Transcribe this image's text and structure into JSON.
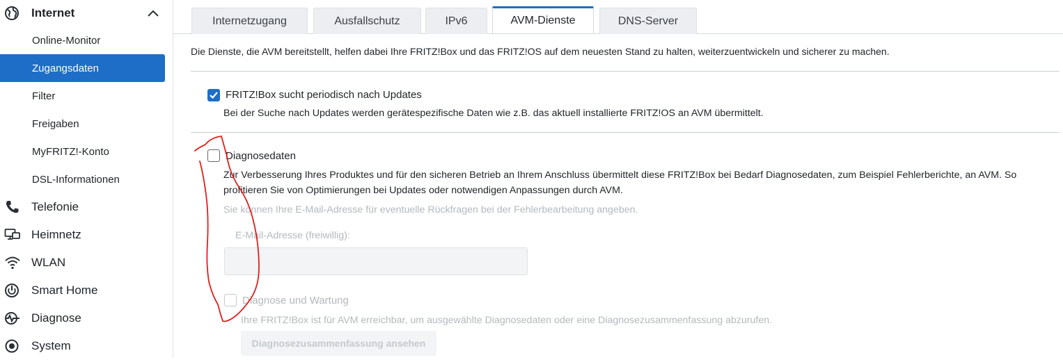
{
  "sidebar": {
    "section": {
      "label": "Internet",
      "icon": "globe-icon",
      "expanded": true
    },
    "sub_items": [
      {
        "label": "Online-Monitor",
        "active": false
      },
      {
        "label": "Zugangsdaten",
        "active": true
      },
      {
        "label": "Filter",
        "active": false
      },
      {
        "label": "Freigaben",
        "active": false
      },
      {
        "label": "MyFRITZ!-Konto",
        "active": false
      },
      {
        "label": "DSL-Informationen",
        "active": false
      }
    ],
    "main_items": [
      {
        "label": "Telefonie",
        "icon": "phone-icon"
      },
      {
        "label": "Heimnetz",
        "icon": "network-icon"
      },
      {
        "label": "WLAN",
        "icon": "wifi-icon"
      },
      {
        "label": "Smart Home",
        "icon": "smart-home-icon"
      },
      {
        "label": "Diagnose",
        "icon": "diagnose-icon"
      },
      {
        "label": "System",
        "icon": "system-icon"
      }
    ]
  },
  "tabs": [
    {
      "label": "Internetzugang",
      "active": false
    },
    {
      "label": "Ausfallschutz",
      "active": false
    },
    {
      "label": "IPv6",
      "active": false
    },
    {
      "label": "AVM-Dienste",
      "active": true
    },
    {
      "label": "DNS-Server",
      "active": false
    }
  ],
  "content": {
    "intro": "Die Dienste, die AVM bereitstellt, helfen dabei Ihre FRITZ!Box und das FRITZ!OS auf dem neuesten Stand zu halten, weiterzuentwickeln und sicherer zu machen.",
    "updates": {
      "label": "FRITZ!Box sucht periodisch nach Updates",
      "checked": true,
      "description": "Bei der Suche nach Updates werden gerätespezifische Daten wie z.B. das aktuell installierte FRITZ!OS an AVM übermittelt."
    },
    "diagnostics": {
      "label": "Diagnosedaten",
      "checked": false,
      "description": "Zur Verbesserung Ihres Produktes und für den sicheren Betrieb an Ihrem Anschluss übermittelt diese FRITZ!Box bei Bedarf Diagnosedaten, zum Beispiel Fehlerberichte, an AVM. So profitieren Sie von Optimierungen bei Updates oder notwendigen Anpassungen durch AVM.",
      "email_hint": "Sie können Ihre E-Mail-Adresse für eventuelle Rückfragen bei der Fehlerbearbeitung angeben.",
      "email_label": "E-Mail-Adresse (freiwillig):",
      "email_value": ""
    },
    "maintenance": {
      "label": "Diagnose und Wartung",
      "checked": false,
      "disabled": true,
      "description": "Ihre FRITZ!Box ist für AVM erreichbar, um ausgewählte Diagnosedaten oder eine Diagnosezusammenfassung abzurufen.",
      "button_label": "Diagnosezusammenfassung ansehen"
    }
  },
  "colors": {
    "accent": "#1e6ec8",
    "annotation": "#e0201c",
    "disabled": "#b3b8be"
  }
}
